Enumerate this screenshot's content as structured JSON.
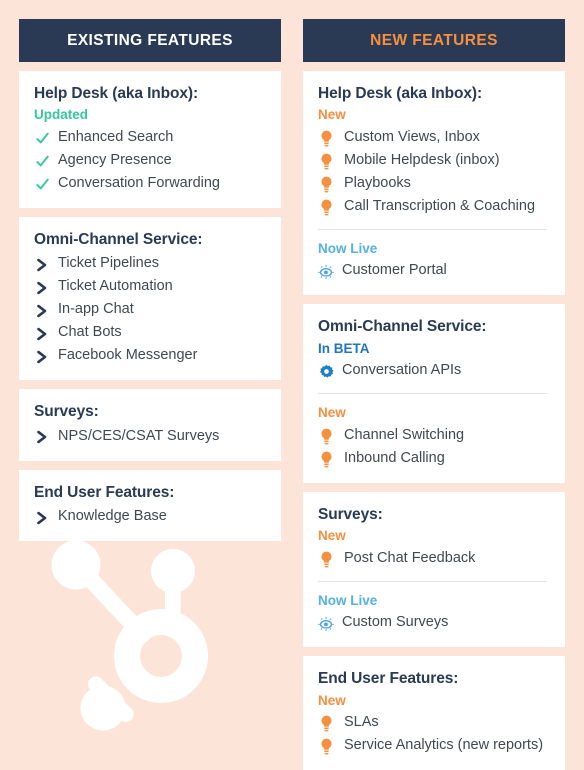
{
  "theme": {
    "background": "#fce5d8",
    "header_bar": "#2a3a55",
    "card_bg": "#ffffff",
    "title_color": "#293b54",
    "body_text": "#41484f",
    "accent_orange": "#f5903f",
    "accent_green": "#33c99c",
    "accent_lightblue": "#55b0e6",
    "accent_blue": "#2176bd",
    "divider": "#e3e3e3"
  },
  "columns": [
    {
      "key": "existing",
      "header": "EXISTING FEATURES",
      "header_text_color": "#ffffff",
      "cards": [
        {
          "title": "Help Desk (aka Inbox):",
          "groups": [
            {
              "status": "Updated",
              "status_type": "updated",
              "icon": "check-icon",
              "items": [
                "Enhanced Search",
                "Agency Presence",
                "Conversation Forwarding"
              ]
            }
          ]
        },
        {
          "title": "Omni-Channel Service:",
          "groups": [
            {
              "status": "",
              "status_type": "none",
              "icon": "chevron-icon",
              "items": [
                "Ticket Pipelines",
                "Ticket Automation",
                "In-app Chat",
                "Chat Bots",
                "Facebook Messenger"
              ]
            }
          ]
        },
        {
          "title": "Surveys:",
          "groups": [
            {
              "status": "",
              "status_type": "none",
              "icon": "chevron-icon",
              "items": [
                "NPS/CES/CSAT Surveys"
              ]
            }
          ]
        },
        {
          "title": "End User Features:",
          "groups": [
            {
              "status": "",
              "status_type": "none",
              "icon": "chevron-icon",
              "items": [
                "Knowledge Base"
              ]
            }
          ]
        }
      ]
    },
    {
      "key": "new",
      "header": "NEW FEATURES",
      "header_text_color": "#f5903f",
      "cards": [
        {
          "title": "Help Desk (aka Inbox):",
          "groups": [
            {
              "status": "New",
              "status_type": "new",
              "icon": "lightbulb-icon",
              "items": [
                "Custom Views, Inbox",
                "Mobile Helpdesk (inbox)",
                "Playbooks",
                "Call Transcription & Coaching"
              ]
            },
            {
              "status": "Now Live",
              "status_type": "live",
              "icon": "eye-icon",
              "items": [
                "Customer Portal"
              ]
            }
          ]
        },
        {
          "title": "Omni-Channel Service:",
          "groups": [
            {
              "status": "In BETA",
              "status_type": "beta",
              "icon": "gear-icon",
              "items": [
                "Conversation APIs"
              ]
            },
            {
              "status": "New",
              "status_type": "new",
              "icon": "lightbulb-icon",
              "items": [
                "Channel Switching",
                "Inbound Calling"
              ]
            }
          ]
        },
        {
          "title": "Surveys:",
          "groups": [
            {
              "status": "New",
              "status_type": "new",
              "icon": "lightbulb-icon",
              "items": [
                "Post Chat Feedback"
              ]
            },
            {
              "status": "Now Live",
              "status_type": "live",
              "icon": "eye-icon",
              "items": [
                "Custom Surveys"
              ]
            }
          ]
        },
        {
          "title": "End User Features:",
          "groups": [
            {
              "status": "New",
              "status_type": "new",
              "icon": "lightbulb-icon",
              "items": [
                "SLAs",
                "Service Analytics (new reports)"
              ]
            }
          ]
        }
      ]
    }
  ],
  "watermark": {
    "icon": "hubspot-sprocket-logo",
    "color": "#ffffff"
  }
}
